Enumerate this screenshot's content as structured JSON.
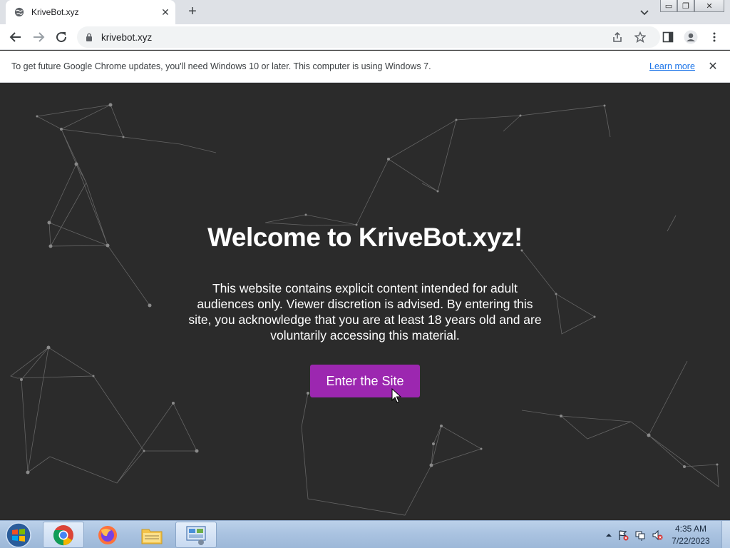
{
  "browser": {
    "tab": {
      "title": "KriveBot.xyz",
      "close_label": "✕"
    },
    "new_tab_label": "+",
    "window_controls": {
      "minimize": "▭",
      "restore": "❐",
      "close": "✕"
    },
    "address": {
      "url": "krivebot.xyz"
    }
  },
  "infobar": {
    "message": "To get future Google Chrome updates, you'll need Windows 10 or later. This computer is using Windows 7.",
    "link_label": "Learn more",
    "close_label": "✕"
  },
  "page": {
    "title": "Welcome to KriveBot.xyz!",
    "description": "This website contains explicit content intended for adult audiences only. Viewer discretion is advised. By entering this site, you acknowledge that you are at least 18 years old and are voluntarily accessing this material.",
    "enter_button_label": "Enter the Site",
    "colors": {
      "background": "#2b2b2b",
      "button": "#9c27b0",
      "text": "#ffffff"
    }
  },
  "taskbar": {
    "pinned": [
      "chrome-icon",
      "firefox-icon",
      "explorer-icon",
      "control-panel-icon"
    ],
    "clock": {
      "time": "4:35 AM",
      "date": "7/22/2023"
    }
  }
}
